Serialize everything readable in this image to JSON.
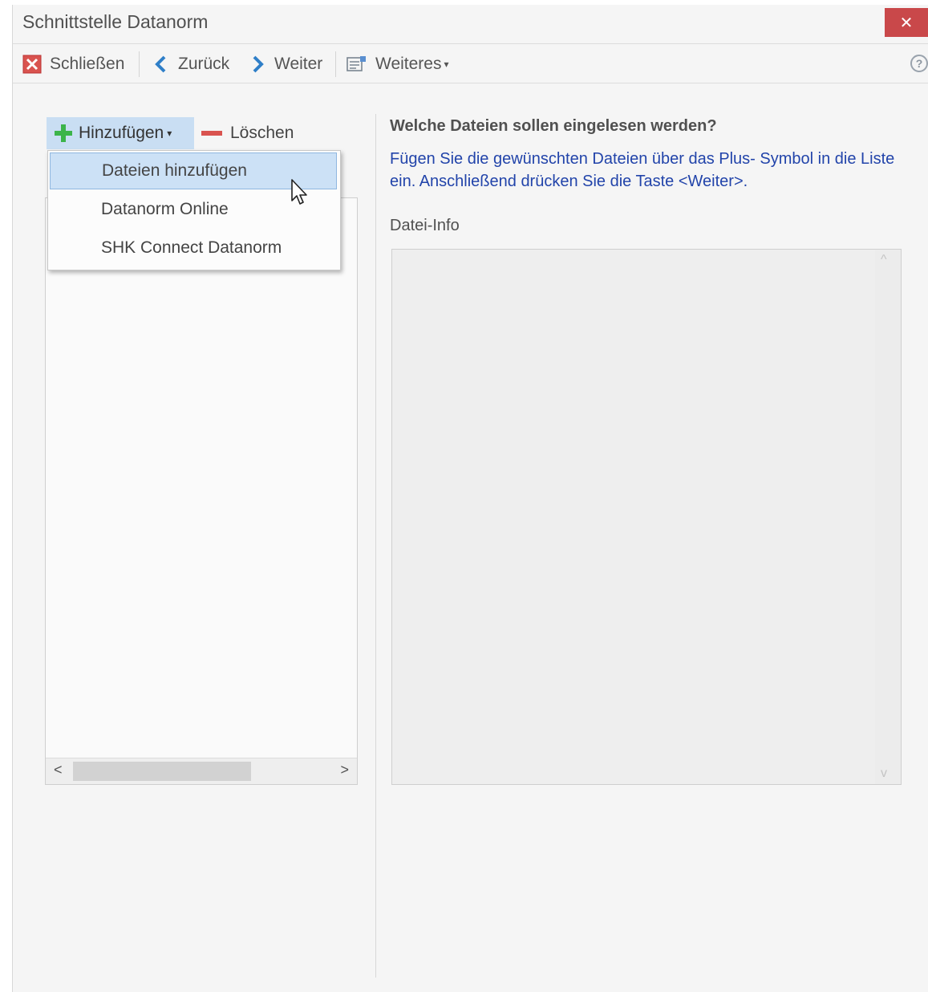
{
  "window": {
    "title": "Schnittstelle Datanorm",
    "close_glyph": "✕"
  },
  "toolbar": {
    "close_label": "Schließen",
    "back_label": "Zurück",
    "next_label": "Weiter",
    "more_label": "Weiteres",
    "more_arrow": "▾",
    "help_glyph": "?"
  },
  "left_pane": {
    "add_label": "Hinzufügen",
    "add_arrow": "▾",
    "delete_label": "Löschen",
    "scroll_left": "<",
    "scroll_right": ">"
  },
  "add_menu": {
    "items": [
      {
        "label": "Dateien hinzufügen"
      },
      {
        "label": "Datanorm Online"
      },
      {
        "label": "SHK Connect Datanorm"
      }
    ]
  },
  "right_pane": {
    "heading": "Welche Dateien sollen eingelesen werden?",
    "instruction": "Fügen Sie die gewünschten Dateien über das Plus- Symbol in die Liste ein. Anschließend drücken Sie die Taste <Weiter>.",
    "file_info_label": "Datei-Info",
    "scroll_up": "^",
    "scroll_down": "v"
  },
  "colors": {
    "close_red": "#c9484a",
    "highlight_blue": "#c9def3",
    "link_blue": "#2244aa",
    "plus_green": "#3cb44a",
    "minus_red": "#d9534f",
    "chevron_blue": "#2f7fc8"
  },
  "icons": {
    "close_toolbar": "close-red-box-icon",
    "back": "chevron-left-icon",
    "next": "chevron-right-icon",
    "more": "document-list-icon",
    "help": "help-circle-icon",
    "add": "plus-icon",
    "delete": "minus-icon"
  }
}
